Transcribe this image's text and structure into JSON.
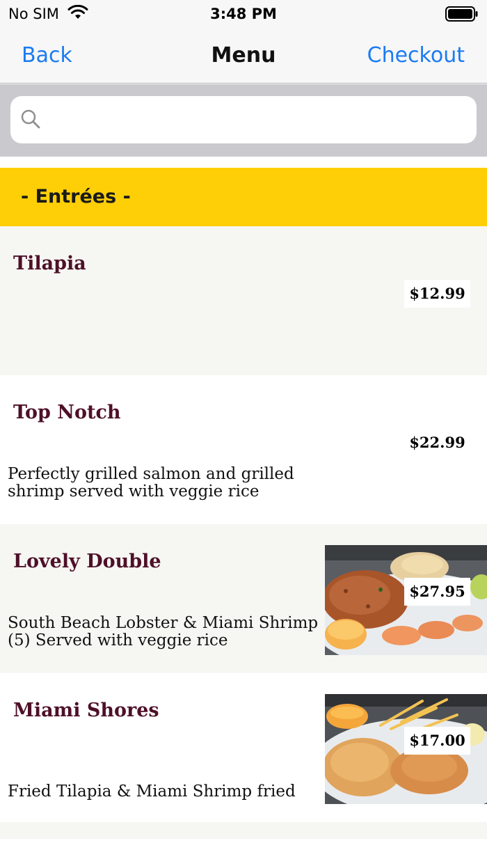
{
  "status_bar": {
    "carrier": "No SIM",
    "time": "3:48 PM",
    "wifi_icon": "wifi-icon",
    "battery_icon": "battery-icon"
  },
  "nav": {
    "back_label": "Back",
    "title": "Menu",
    "checkout_label": "Checkout",
    "accent_color": "#1a7bf2"
  },
  "search": {
    "placeholder": "",
    "value": "",
    "icon": "search-icon"
  },
  "section": {
    "title": "- Entrées -",
    "color": "#fecf07"
  },
  "items": [
    {
      "name": "Tilapia",
      "price": "$12.99",
      "description": "",
      "has_photo": false
    },
    {
      "name": "Top Notch",
      "price": "$22.99",
      "description": "Perfectly grilled salmon and grilled shrimp served with veggie rice",
      "has_photo": false
    },
    {
      "name": "Lovely Double",
      "price": "$27.95",
      "description": "South Beach Lobster & Miami Shrimp (5) Served with veggie rice",
      "has_photo": true
    },
    {
      "name": "Miami Shores",
      "price": "$17.00",
      "description": "Fried Tilapia & Miami Shrimp fried",
      "has_photo": true
    }
  ],
  "colors": {
    "item_name": "#4e1028",
    "row_alt": "#f6f7f3"
  }
}
